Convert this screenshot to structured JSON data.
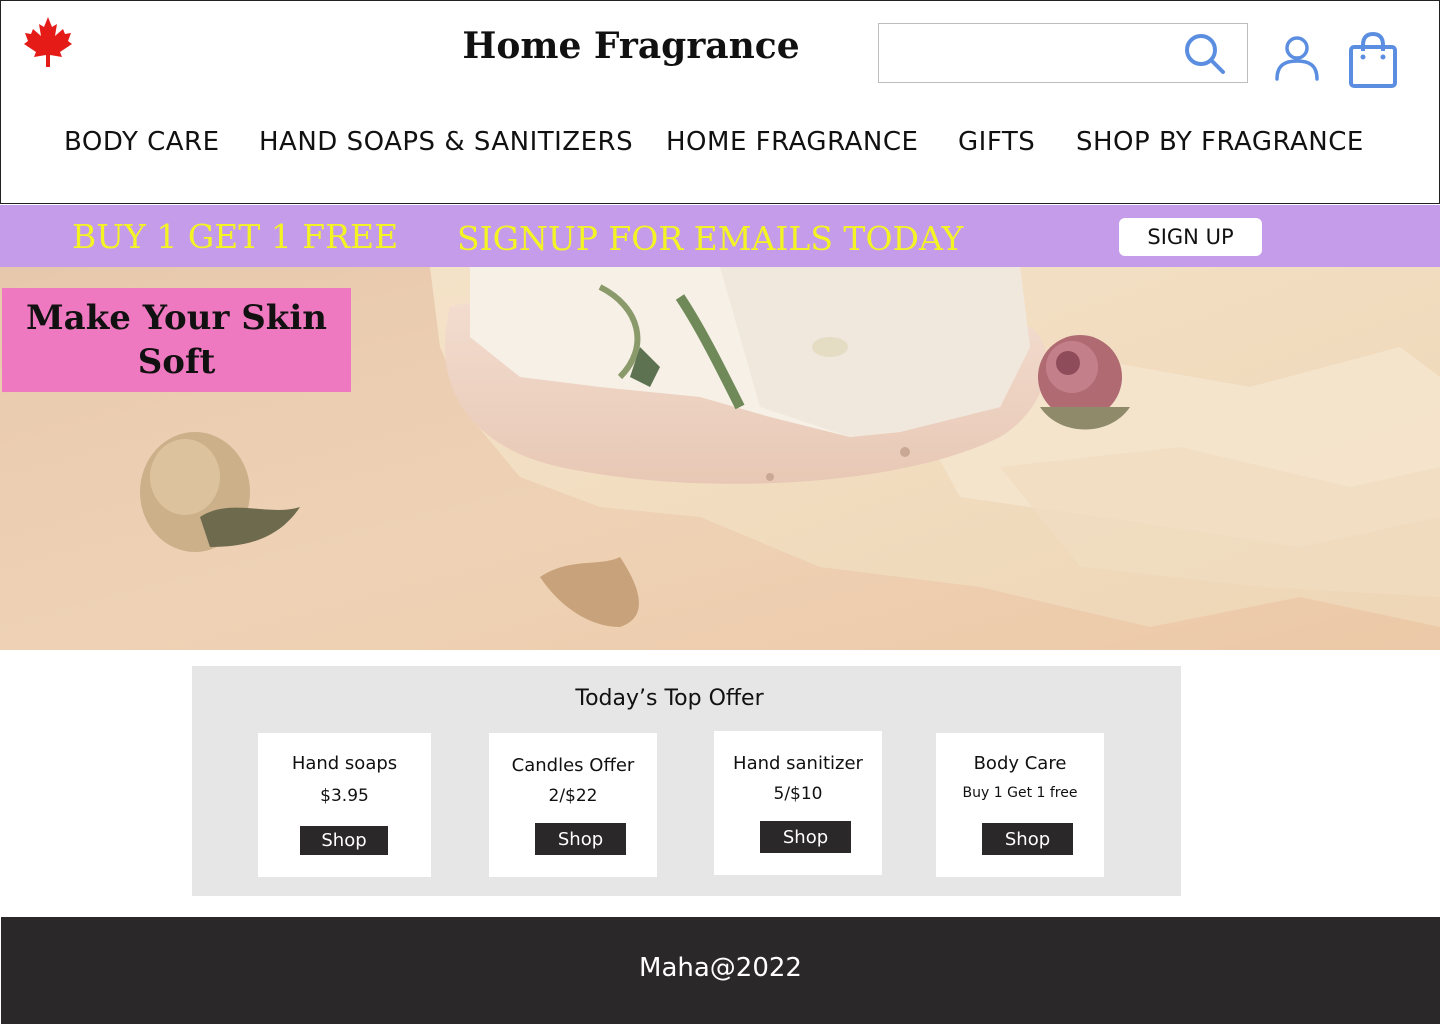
{
  "header": {
    "title": "Home Fragrance",
    "search": {
      "value": "",
      "placeholder": ""
    },
    "icons": {
      "flag": "maple-leaf-icon",
      "search": "search-icon",
      "account": "user-icon",
      "cart": "shopping-bag-icon"
    },
    "accent_color": "#5b8ee0",
    "flag_color": "#e41b17"
  },
  "nav": {
    "items": [
      {
        "label": "BODY CARE"
      },
      {
        "label": "HAND SOAPS & SANITIZERS"
      },
      {
        "label": "HOME FRAGRANCE"
      },
      {
        "label": "GIFTS"
      },
      {
        "label": "SHOP BY FRAGRANCE"
      }
    ]
  },
  "promo": {
    "offer": "BUY 1 GET 1 FREE",
    "signup_text": "SIGNUP FOR EMAILS TODAY",
    "signup_button": "SIGN UP",
    "background": "#c59cea",
    "text_color": "#f4f425"
  },
  "hero": {
    "tag": "Make Your Skin Soft",
    "tag_color": "#ef79c0"
  },
  "offers": {
    "title": "Today’s Top Offer",
    "cards": [
      {
        "title": "Hand soaps",
        "price": "$3.95",
        "button": "Shop"
      },
      {
        "title": "Candles Offer",
        "price": "2/$22",
        "button": "Shop"
      },
      {
        "title": "Hand sanitizer",
        "price": "5/$10",
        "button": "Shop"
      },
      {
        "title": "Body Care",
        "price": "Buy 1 Get 1 free",
        "button": "Shop"
      }
    ]
  },
  "footer": {
    "text": "Maha@2022"
  }
}
